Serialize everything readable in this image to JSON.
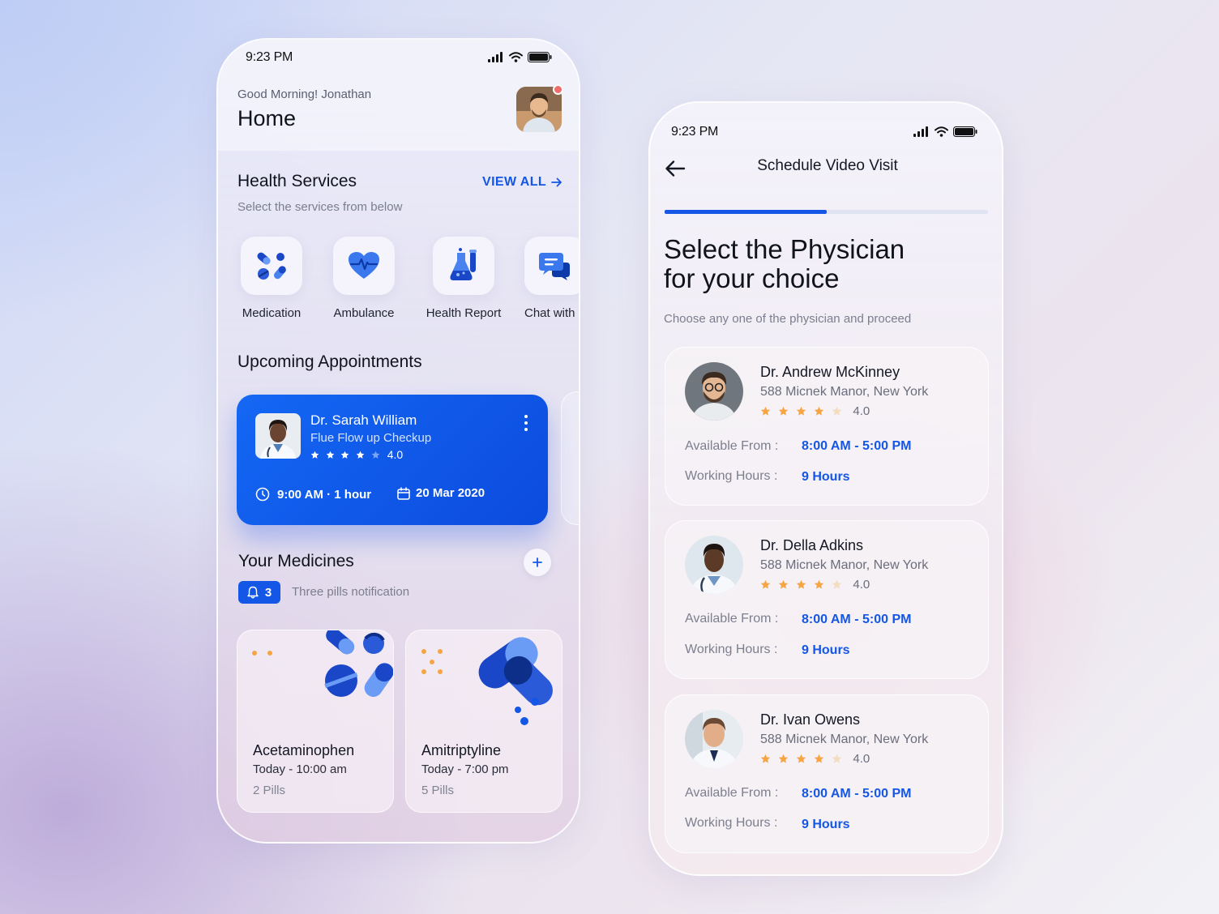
{
  "colors": {
    "accent": "#1456e6",
    "star": "#f5a544",
    "badge_dot": "#f06b6b"
  },
  "home": {
    "status_time": "9:23 PM",
    "greeting": "Good Morning! Jonathan",
    "title": "Home",
    "health_services": {
      "title": "Health Services",
      "subtitle": "Select the services from below",
      "view_all": "VIEW ALL",
      "items": [
        {
          "label": "Medication",
          "icon": "pills-icon"
        },
        {
          "label": "Ambulance",
          "icon": "heartbeat-icon"
        },
        {
          "label": "Health Report",
          "icon": "lab-flask-icon"
        },
        {
          "label": "Chat with",
          "icon": "chat-bubbles-icon"
        }
      ]
    },
    "appointments": {
      "title": "Upcoming Appointments",
      "card": {
        "doctor": "Dr. Sarah William",
        "reason": "Flue Flow up Checkup",
        "rating": "4.0",
        "rating_value": 4,
        "time": "9:00 AM · 1 hour",
        "date": "20 Mar 2020"
      }
    },
    "medicines": {
      "title": "Your Medicines",
      "badge_count": "3",
      "notification": "Three pills notification",
      "items": [
        {
          "name": "Acetaminophen",
          "time": "Today - 10:00 am",
          "pills": "2 Pills"
        },
        {
          "name": "Amitriptyline",
          "time": "Today - 7:00 pm",
          "pills": "5 Pills"
        }
      ]
    }
  },
  "schedule": {
    "status_time": "9:23 PM",
    "title": "Schedule Video Visit",
    "progress": 0.5,
    "heading_line1": "Select the Physician",
    "heading_line2": "for your choice",
    "subtitle": "Choose any one of the physician and proceed",
    "available_label": "Available From :",
    "working_label": "Working Hours :",
    "physicians": [
      {
        "name": "Dr. Andrew McKinney",
        "address": "588 Micnek Manor, New York",
        "rating": "4.0",
        "rating_value": 4,
        "available": "8:00 AM - 5:00 PM",
        "hours": "9 Hours"
      },
      {
        "name": "Dr. Della Adkins",
        "address": "588 Micnek Manor, New York",
        "rating": "4.0",
        "rating_value": 4,
        "available": "8:00 AM - 5:00 PM",
        "hours": "9 Hours"
      },
      {
        "name": "Dr. Ivan Owens",
        "address": "588 Micnek Manor, New York",
        "rating": "4.0",
        "rating_value": 4,
        "available": "8:00 AM - 5:00 PM",
        "hours": "9 Hours"
      }
    ]
  }
}
